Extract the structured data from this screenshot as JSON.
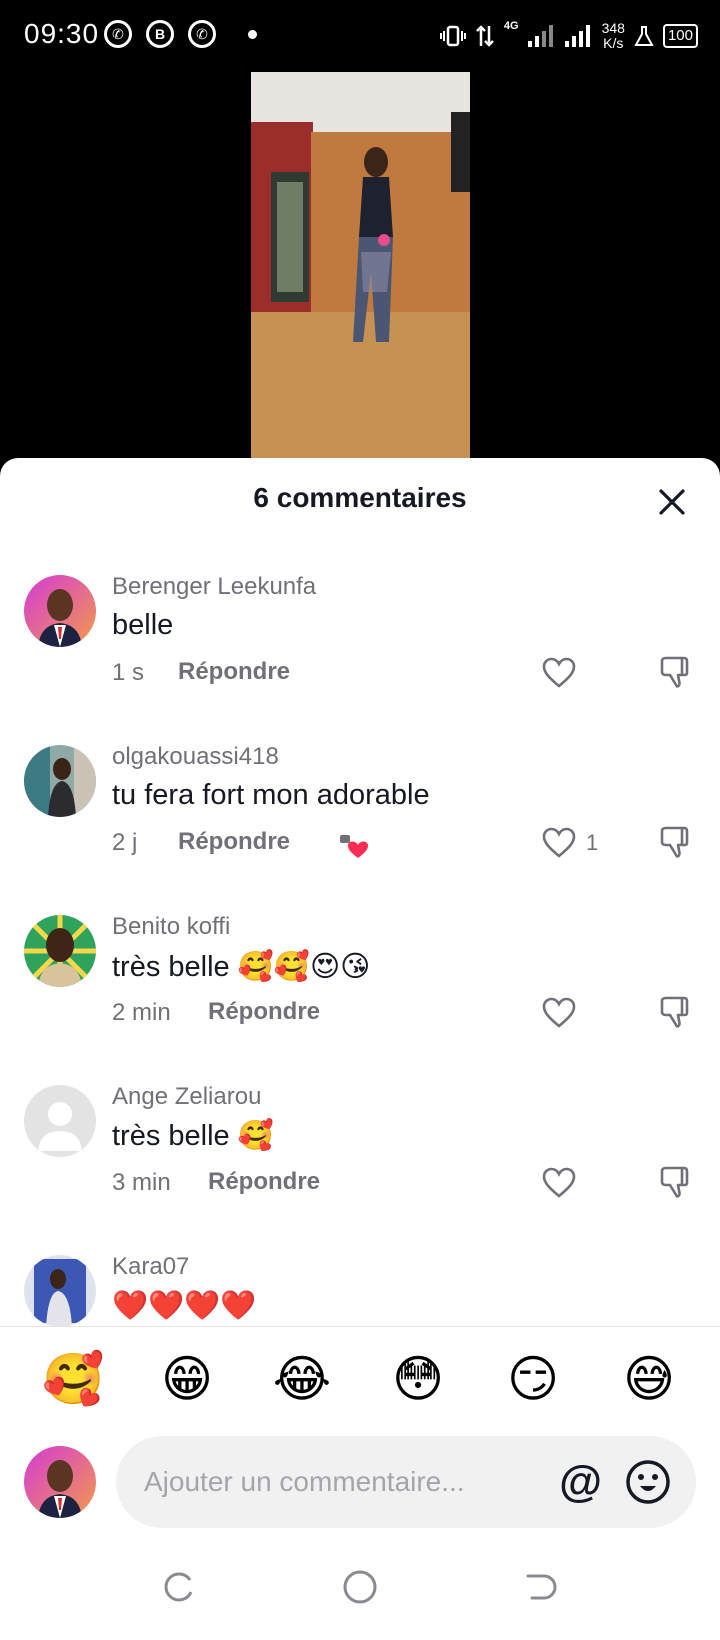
{
  "status_bar": {
    "time": "09:30",
    "network": "4G",
    "speed_value": "348",
    "speed_unit": "K/s",
    "battery": "100"
  },
  "sheet": {
    "title": "6 commentaires"
  },
  "comments": [
    {
      "username": "Berenger Leekunfa",
      "text": "belle",
      "time": "1 s",
      "reply_label": "Répondre",
      "likes": ""
    },
    {
      "username": "olgakouassi418",
      "text": "tu fera fort mon adorable",
      "time": "2 j",
      "reply_label": "Répondre",
      "likes": "1"
    },
    {
      "username": "Benito koffi",
      "text": "très belle 🥰🥰😍😘",
      "time": "2 min",
      "reply_label": "Répondre",
      "likes": ""
    },
    {
      "username": "Ange Zeliarou",
      "text": "très belle 🥰",
      "time": "3 min",
      "reply_label": "Répondre",
      "likes": ""
    },
    {
      "username": "Kara07",
      "text": "❤️❤️❤️❤️",
      "time": "",
      "reply_label": "",
      "likes": ""
    }
  ],
  "quick_emojis": [
    "🥰",
    "😁",
    "😂",
    "😳",
    "😏",
    "😅"
  ],
  "input": {
    "placeholder": "Ajouter un commentaire..."
  },
  "colors": {
    "accent": "#fe2c55",
    "text": "#161823",
    "secondary": "#6f7078"
  }
}
